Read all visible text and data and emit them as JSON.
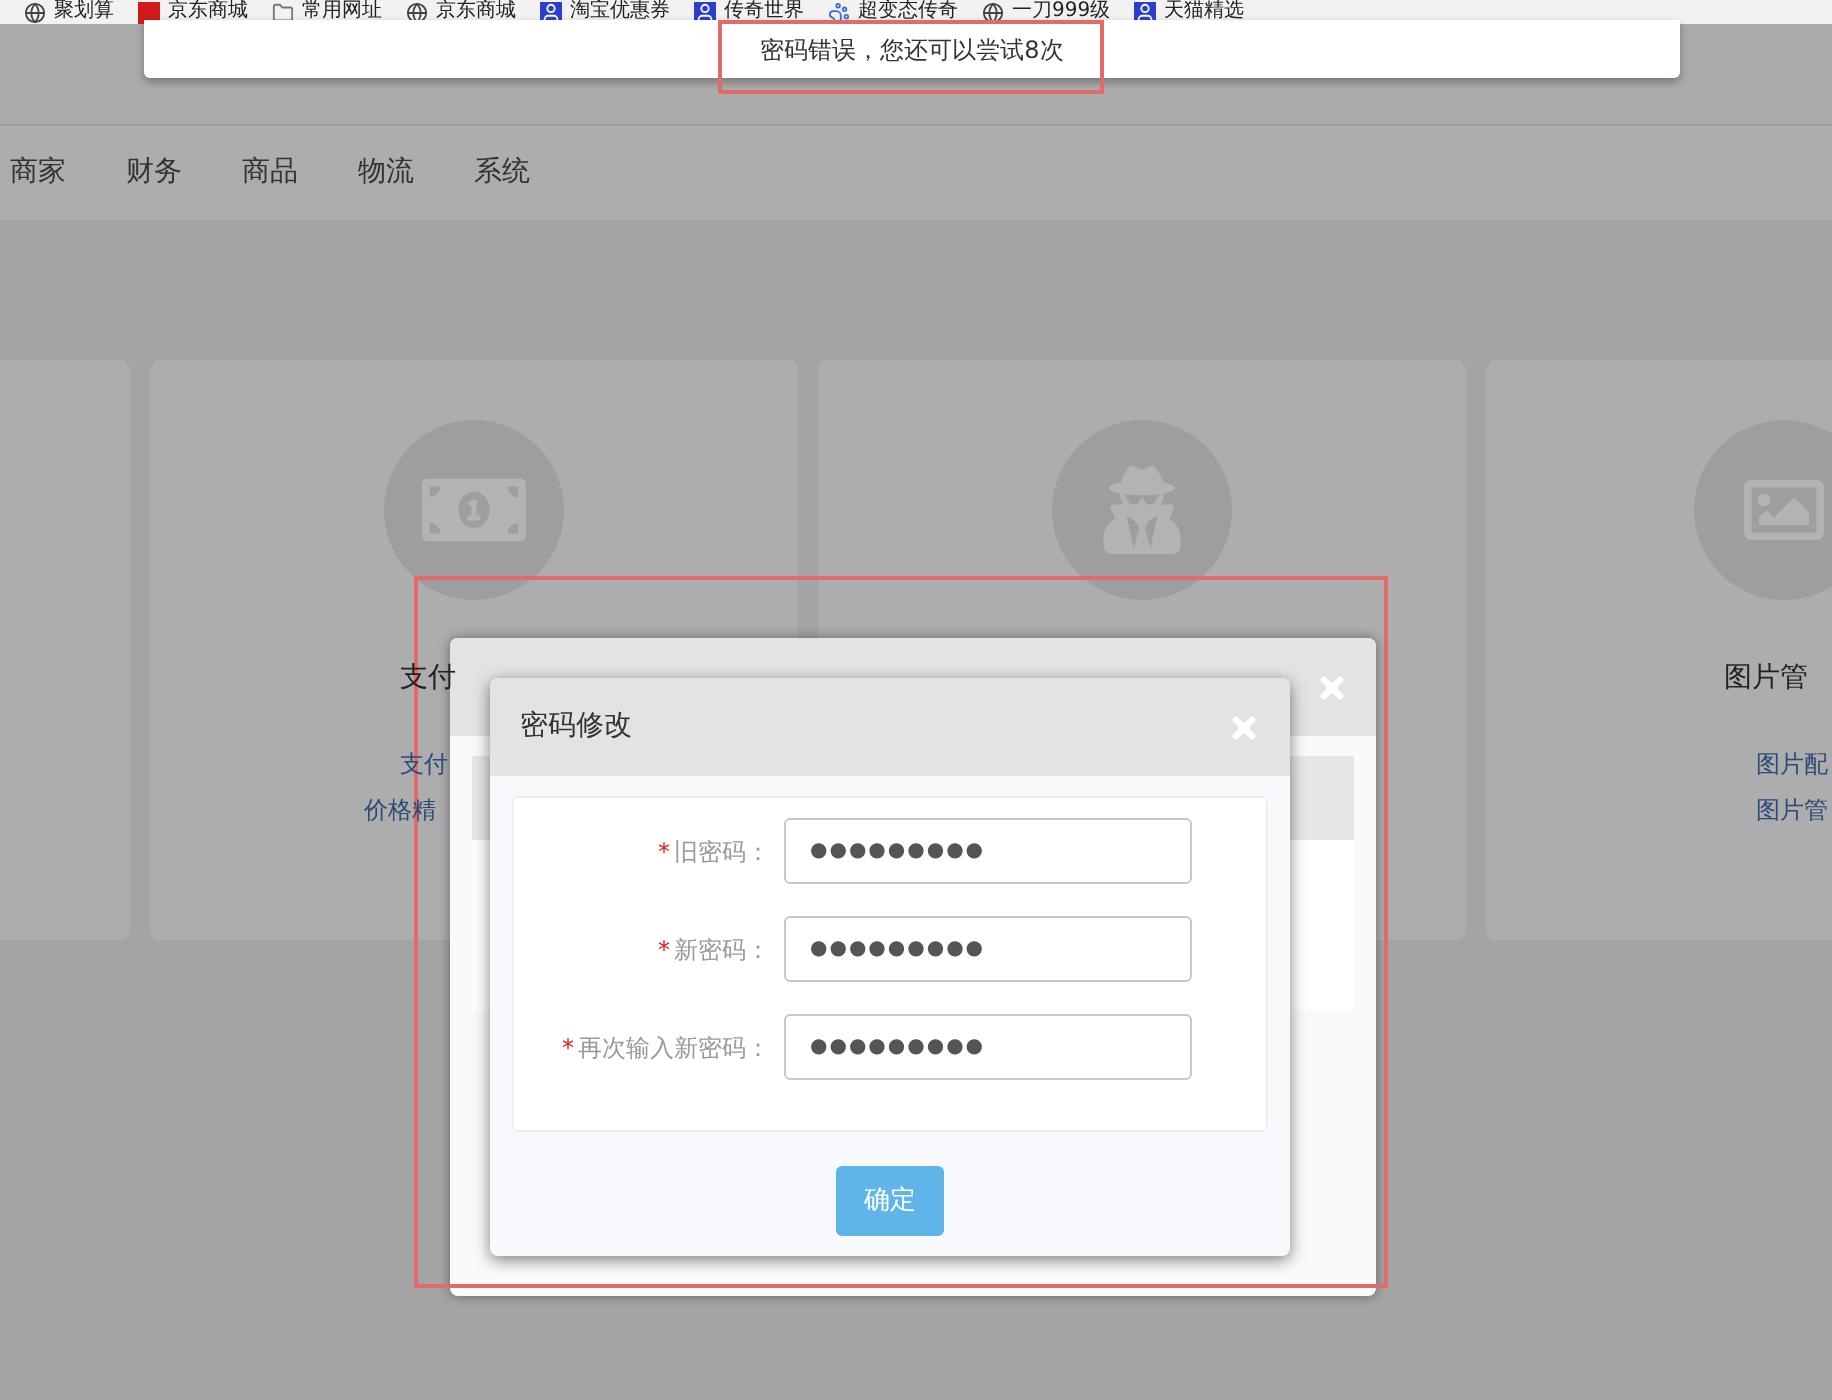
{
  "bookmarks": [
    {
      "kind": "globe",
      "label": "聚划算"
    },
    {
      "kind": "store",
      "label": "京东商城"
    },
    {
      "kind": "folder",
      "label": "常用网址"
    },
    {
      "kind": "globe",
      "label": "京东商城"
    },
    {
      "kind": "person",
      "label": "淘宝优惠券"
    },
    {
      "kind": "person",
      "label": "传奇世界"
    },
    {
      "kind": "paw",
      "label": "超变态传奇"
    },
    {
      "kind": "globe",
      "label": "一刀999级"
    },
    {
      "kind": "person",
      "label": "天猫精选"
    }
  ],
  "toast": {
    "message": "密码错误，您还可以尝试8次"
  },
  "nav": [
    "商家",
    "财务",
    "商品",
    "物流",
    "系统"
  ],
  "cards": [
    {
      "kind": "blank"
    },
    {
      "kind": "money",
      "title": "支付",
      "links": [
        "支付",
        "价格精"
      ]
    },
    {
      "kind": "spy"
    },
    {
      "kind": "image",
      "title": "图片管",
      "links": [
        "图片配",
        "图片管"
      ]
    }
  ],
  "dialog": {
    "title": "密码修改",
    "fields": [
      {
        "mark": "*",
        "label": "旧密码：",
        "value": "●●●●●●●●●"
      },
      {
        "mark": "*",
        "label": "新密码：",
        "value": "●●●●●●●●●"
      },
      {
        "mark": "*",
        "label": "再次输入新密码：",
        "value": "●●●●●●●●●"
      }
    ],
    "button": "确定"
  }
}
